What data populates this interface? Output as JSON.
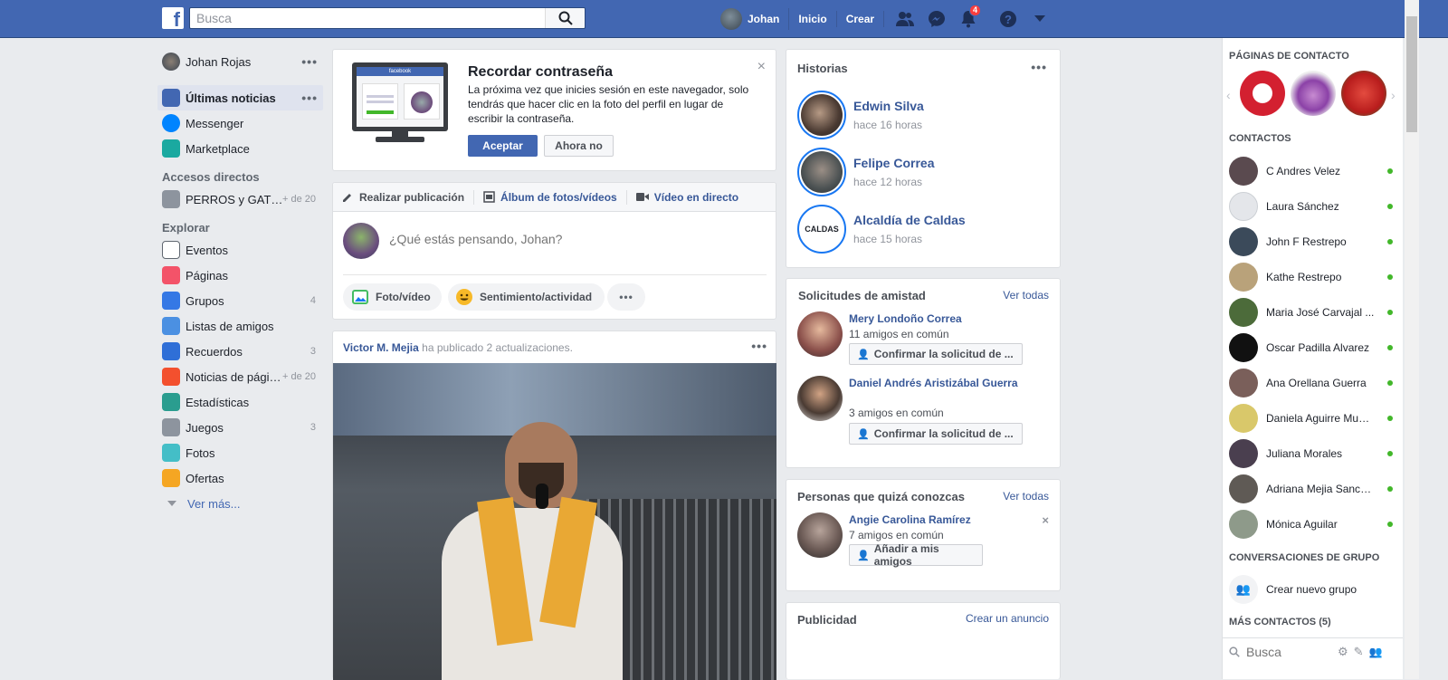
{
  "header": {
    "search_placeholder": "Busca",
    "user_name": "Johan",
    "home_label": "Inicio",
    "create_label": "Crear",
    "notification_count": "4",
    "brand_color": "#4267b2"
  },
  "leftnav": {
    "profile_name": "Johan Rojas",
    "items_top": [
      {
        "label": "Últimas noticias",
        "icon": "news-feed-icon"
      },
      {
        "label": "Messenger",
        "icon": "messenger-icon"
      },
      {
        "label": "Marketplace",
        "icon": "marketplace-icon"
      }
    ],
    "shortcuts_title": "Accesos directos",
    "shortcut": {
      "label": "PERROS y GAT…",
      "count": "+ de 20"
    },
    "explore_title": "Explorar",
    "explore_items": [
      {
        "label": "Eventos",
        "count": "",
        "icon": "events-icon"
      },
      {
        "label": "Páginas",
        "count": "",
        "icon": "pages-icon"
      },
      {
        "label": "Grupos",
        "count": "4",
        "icon": "groups-icon"
      },
      {
        "label": "Listas de amigos",
        "count": "",
        "icon": "friend-lists-icon"
      },
      {
        "label": "Recuerdos",
        "count": "3",
        "icon": "memories-icon"
      },
      {
        "label": "Noticias de pági…",
        "count": "+ de 20",
        "icon": "pages-feed-icon"
      },
      {
        "label": "Estadísticas",
        "count": "",
        "icon": "stats-icon"
      },
      {
        "label": "Juegos",
        "count": "3",
        "icon": "games-icon"
      },
      {
        "label": "Fotos",
        "count": "",
        "icon": "photos-icon"
      },
      {
        "label": "Ofertas",
        "count": "",
        "icon": "offers-icon"
      }
    ],
    "see_more": "Ver más..."
  },
  "password_card": {
    "title": "Recordar contraseña",
    "body": "La próxima vez que inicies sesión en este navegador, solo tendrás que hacer clic en la foto del perfil en lugar de escribir la contraseña.",
    "accept": "Aceptar",
    "decline": "Ahora no",
    "illustration_logo": "facebook"
  },
  "composer": {
    "tab_post": "Realizar publicación",
    "tab_album": "Álbum de fotos/vídeos",
    "tab_live": "Vídeo en directo",
    "placeholder": "¿Qué estás pensando, Johan?",
    "photo_video": "Foto/vídeo",
    "feeling": "Sentimiento/actividad"
  },
  "post": {
    "author": "Victor M. Mejia",
    "action": "ha publicado 2 actualizaciones."
  },
  "stories": {
    "title": "Historias",
    "items": [
      {
        "name": "Edwin Silva",
        "time": "hace 16 horas"
      },
      {
        "name": "Felipe Correa",
        "time": "hace 12 horas"
      },
      {
        "name": "Alcaldía de Caldas",
        "time": "hace 15 horas",
        "logo_text": "CALDAS"
      }
    ]
  },
  "friend_requests": {
    "title": "Solicitudes de amistad",
    "see_all": "Ver todas",
    "items": [
      {
        "name": "Mery Londoño Correa",
        "mutual": "11 amigos en común",
        "button": "Confirmar la solicitud de ..."
      },
      {
        "name": "Daniel Andrés Aristizábal Guerra",
        "mutual": "3 amigos en común",
        "button": "Confirmar la solicitud de ..."
      }
    ]
  },
  "pymk": {
    "title": "Personas que quizá conozcas",
    "see_all": "Ver todas",
    "name": "Angie Carolina Ramírez",
    "mutual": "7 amigos en común",
    "button": "Añadir a mis amigos"
  },
  "ads": {
    "title": "Publicidad",
    "create": "Crear un anuncio"
  },
  "chat": {
    "pages_title": "PÁGINAS DE CONTACTO",
    "contacts_title": "CONTACTOS",
    "contacts": [
      {
        "name": "C Andres Velez"
      },
      {
        "name": "Laura Sánchez"
      },
      {
        "name": "John F Restrepo"
      },
      {
        "name": "Kathe Restrepo"
      },
      {
        "name": "Maria José Carvajal ..."
      },
      {
        "name": "Oscar Padilla Alvarez"
      },
      {
        "name": "Ana Orellana Guerra"
      },
      {
        "name": "Daniela Aguirre Muñoz"
      },
      {
        "name": "Juliana Morales"
      },
      {
        "name": "Adriana Mejia Sanchez"
      },
      {
        "name": "Mónica Aguilar"
      }
    ],
    "group_title": "CONVERSACIONES DE GRUPO",
    "create_group": "Crear nuevo grupo",
    "more_contacts": "MÁS CONTACTOS (5)",
    "search_placeholder": "Busca"
  }
}
